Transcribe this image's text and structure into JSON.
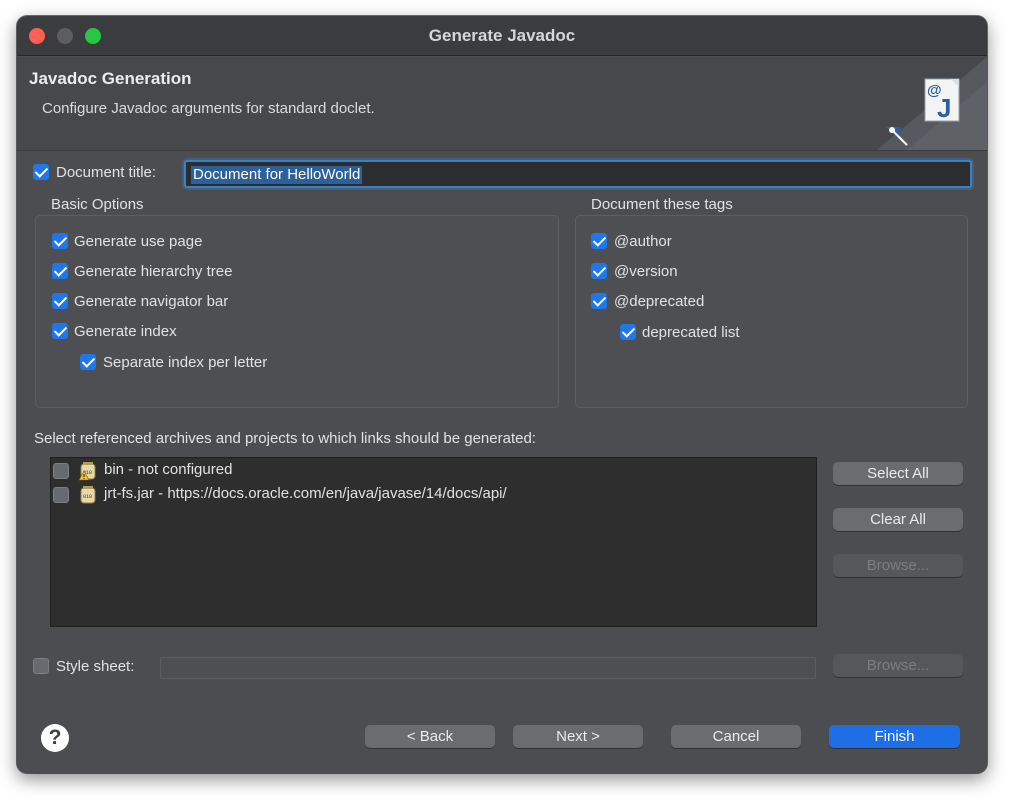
{
  "window": {
    "title": "Generate Javadoc"
  },
  "header": {
    "title": "Javadoc Generation",
    "description": "Configure Javadoc arguments for standard doclet."
  },
  "document_title": {
    "label": "Document title:",
    "checked": true,
    "value": "Document for HelloWorld"
  },
  "basic_options": {
    "title": "Basic Options",
    "items": [
      {
        "label": "Generate use page",
        "checked": true
      },
      {
        "label": "Generate hierarchy tree",
        "checked": true
      },
      {
        "label": "Generate navigator bar",
        "checked": true
      },
      {
        "label": "Generate index",
        "checked": true
      },
      {
        "label": "Separate index per letter",
        "checked": true
      }
    ]
  },
  "tags": {
    "title": "Document these tags",
    "items": [
      {
        "label": "@author",
        "checked": true
      },
      {
        "label": "@version",
        "checked": true
      },
      {
        "label": "@deprecated",
        "checked": true
      },
      {
        "label": "deprecated list",
        "checked": true
      }
    ]
  },
  "archives": {
    "label": "Select referenced archives and projects to which links should be generated:",
    "items": [
      {
        "label": "bin - not configured",
        "checked": false,
        "icon": "jar-warning-icon"
      },
      {
        "label": "jrt-fs.jar - https://docs.oracle.com/en/java/javase/14/docs/api/",
        "checked": false,
        "icon": "jar-icon"
      }
    ],
    "buttons": {
      "select_all": "Select All",
      "clear_all": "Clear All",
      "browse": "Browse..."
    }
  },
  "style_sheet": {
    "label": "Style sheet:",
    "checked": false,
    "value": "",
    "browse": "Browse..."
  },
  "footer": {
    "help": "?",
    "back": "< Back",
    "next": "Next >",
    "cancel": "Cancel",
    "finish": "Finish"
  },
  "colors": {
    "accent": "#1e6fe6",
    "window_bg": "#4b4d50",
    "list_bg": "#2e2e2f",
    "close": "#fe5f57",
    "maximize": "#28c840"
  }
}
